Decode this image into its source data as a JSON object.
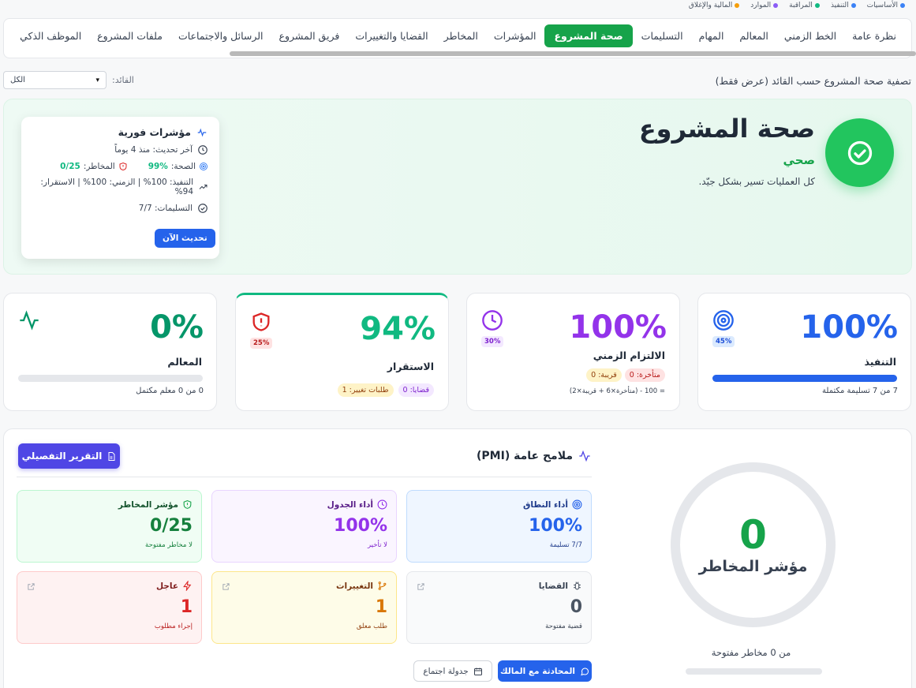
{
  "legend": [
    {
      "label": "الأساسيات",
      "color": "#3b82f6"
    },
    {
      "label": "التنفيذ",
      "color": "#3b82f6"
    },
    {
      "label": "المراقبة",
      "color": "#10b981"
    },
    {
      "label": "الموارد",
      "color": "#8b5cf6"
    },
    {
      "label": "المالية والإغلاق",
      "color": "#f59e0b"
    }
  ],
  "tabs": [
    "نظرة عامة",
    "الخط الزمني",
    "المعالم",
    "المهام",
    "التسليمات",
    "صحة المشروع",
    "المؤشرات",
    "المخاطر",
    "القضايا والتغييرات",
    "فريق المشروع",
    "الرسائل والاجتماعات",
    "ملفات المشروع",
    "الموظف الذكي"
  ],
  "active_tab": "صحة المشروع",
  "filter": {
    "label": "تصفية صحة المشروع حسب القائد (عرض فقط)",
    "leader_label": "القائد:",
    "selected": "الكل"
  },
  "hero": {
    "title": "صحة المشروع",
    "status": "صحي",
    "description": "كل العمليات تسير بشكل جيّد."
  },
  "live": {
    "title": "مؤشرات فورية",
    "last_update": "آخر تحديث: منذ 4 يوماً",
    "health_label": "الصحة:",
    "health_value": "99%",
    "risks_label": "المخاطر:",
    "risks_value": "0/25",
    "execution_line": "التنفيذ: 100% | الزمني: 100% | الاستقرار: 94%",
    "deliverables_line": "التسليمات: 7/7",
    "refresh_button": "تحديث الآن"
  },
  "cards": {
    "execution": {
      "value": "100%",
      "label": "التنفيذ",
      "badge": "45%",
      "sub": "7 من 7 تسليمة مكتملة",
      "progress": 1.0,
      "color": "#2563eb"
    },
    "schedule": {
      "value": "100%",
      "label": "الالتزام الزمني",
      "badge": "30%",
      "late": "متأخرة: 0",
      "near": "قريبة: 0",
      "formula": "= 100 - (متأخرة×6 + قريبة×2)",
      "color": "#9333ea"
    },
    "stability": {
      "value": "94%",
      "label": "الاستقرار",
      "badge": "25%",
      "issues": "قضايا: 0",
      "changes": "طلبات تغيير: 1",
      "color": "#10b981"
    },
    "milestones": {
      "value": "0%",
      "label": "المعالم",
      "sub": "0 من 0 معلم مكتمل",
      "progress": 0,
      "color": "#059669"
    }
  },
  "pmi": {
    "title": "ملامح عامة (PMI)",
    "detail_button": "التقرير التفصيلي",
    "tiles": {
      "scope": {
        "title": "أداء النطاق",
        "value": "100%",
        "sub": "7/7 تسليمة"
      },
      "schedule": {
        "title": "أداء الجدول",
        "value": "100%",
        "sub": "لا تأخير"
      },
      "risk": {
        "title": "مؤشر المخاطر",
        "value": "0/25",
        "sub": "لا مخاطر مفتوحة"
      },
      "issues": {
        "title": "القضايا",
        "value": "0",
        "sub": "قضية مفتوحة"
      },
      "changes": {
        "title": "التغييرات",
        "value": "1",
        "sub": "طلب معلق"
      },
      "urgent": {
        "title": "عاجل",
        "value": "1",
        "sub": "إجراء مطلوب"
      }
    },
    "chat_button": "المحادثة مع المالك",
    "meeting_button": "جدولة اجتماع",
    "risk_ring": {
      "value": "0",
      "label": "مؤشر المخاطر",
      "sub": "من 0 مخاطر مفتوحة"
    }
  }
}
